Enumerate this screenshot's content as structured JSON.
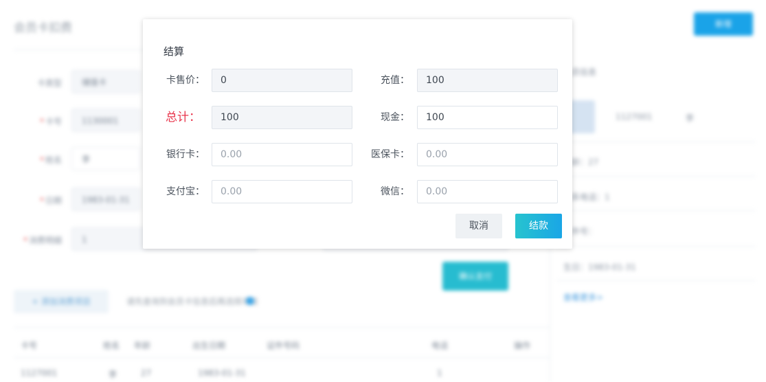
{
  "background": {
    "page_title": "会员卡扣费",
    "top_button": "新增",
    "form": {
      "card_label": "卡类型",
      "card_value": "储值卡",
      "no_label": "卡号",
      "no_value": "1130001",
      "name_label": "姓名",
      "name_value": "李",
      "date_label": "日期",
      "date_value": "1983-01-31",
      "cost_label": "消费明细",
      "cost_value": "1"
    },
    "confirm_button": "确认支付",
    "add_button": "+ 添加消费项目",
    "hint_text": "请先查询到会员卡信息后再选择项目",
    "table_headers": [
      "卡号",
      "姓名",
      "年龄",
      "出生日期",
      "证件号码",
      "电话",
      "操作"
    ],
    "table_row": [
      "1127001",
      "李",
      "27",
      "1983-01-31",
      "",
      "1",
      ""
    ],
    "side": {
      "title": "会员信息",
      "id": "1127001",
      "name": "李",
      "age": "年龄：27",
      "phone": "联系电话：1",
      "idcard": "证件号：",
      "birthday": "生日：1983-01-31",
      "more": "查看更多>"
    }
  },
  "modal": {
    "title": "结算",
    "fields": {
      "card_price": {
        "label": "卡售价：",
        "value": "0"
      },
      "recharge": {
        "label": "充值：",
        "value": "100"
      },
      "total": {
        "label": "总计：",
        "value": "100"
      },
      "cash": {
        "label": "现金：",
        "value": "100"
      },
      "bank_card": {
        "label": "银行卡：",
        "placeholder": "0.00"
      },
      "medical_card": {
        "label": "医保卡：",
        "placeholder": "0.00"
      },
      "alipay": {
        "label": "支付宝：",
        "placeholder": "0.00"
      },
      "wechat": {
        "label": "微信：",
        "placeholder": "0.00"
      }
    },
    "cancel_label": "取消",
    "pay_label": "结款"
  },
  "colors": {
    "accent": "#1aa6e6",
    "accent_teal": "#27c3cf",
    "total_red": "#e8334a"
  }
}
